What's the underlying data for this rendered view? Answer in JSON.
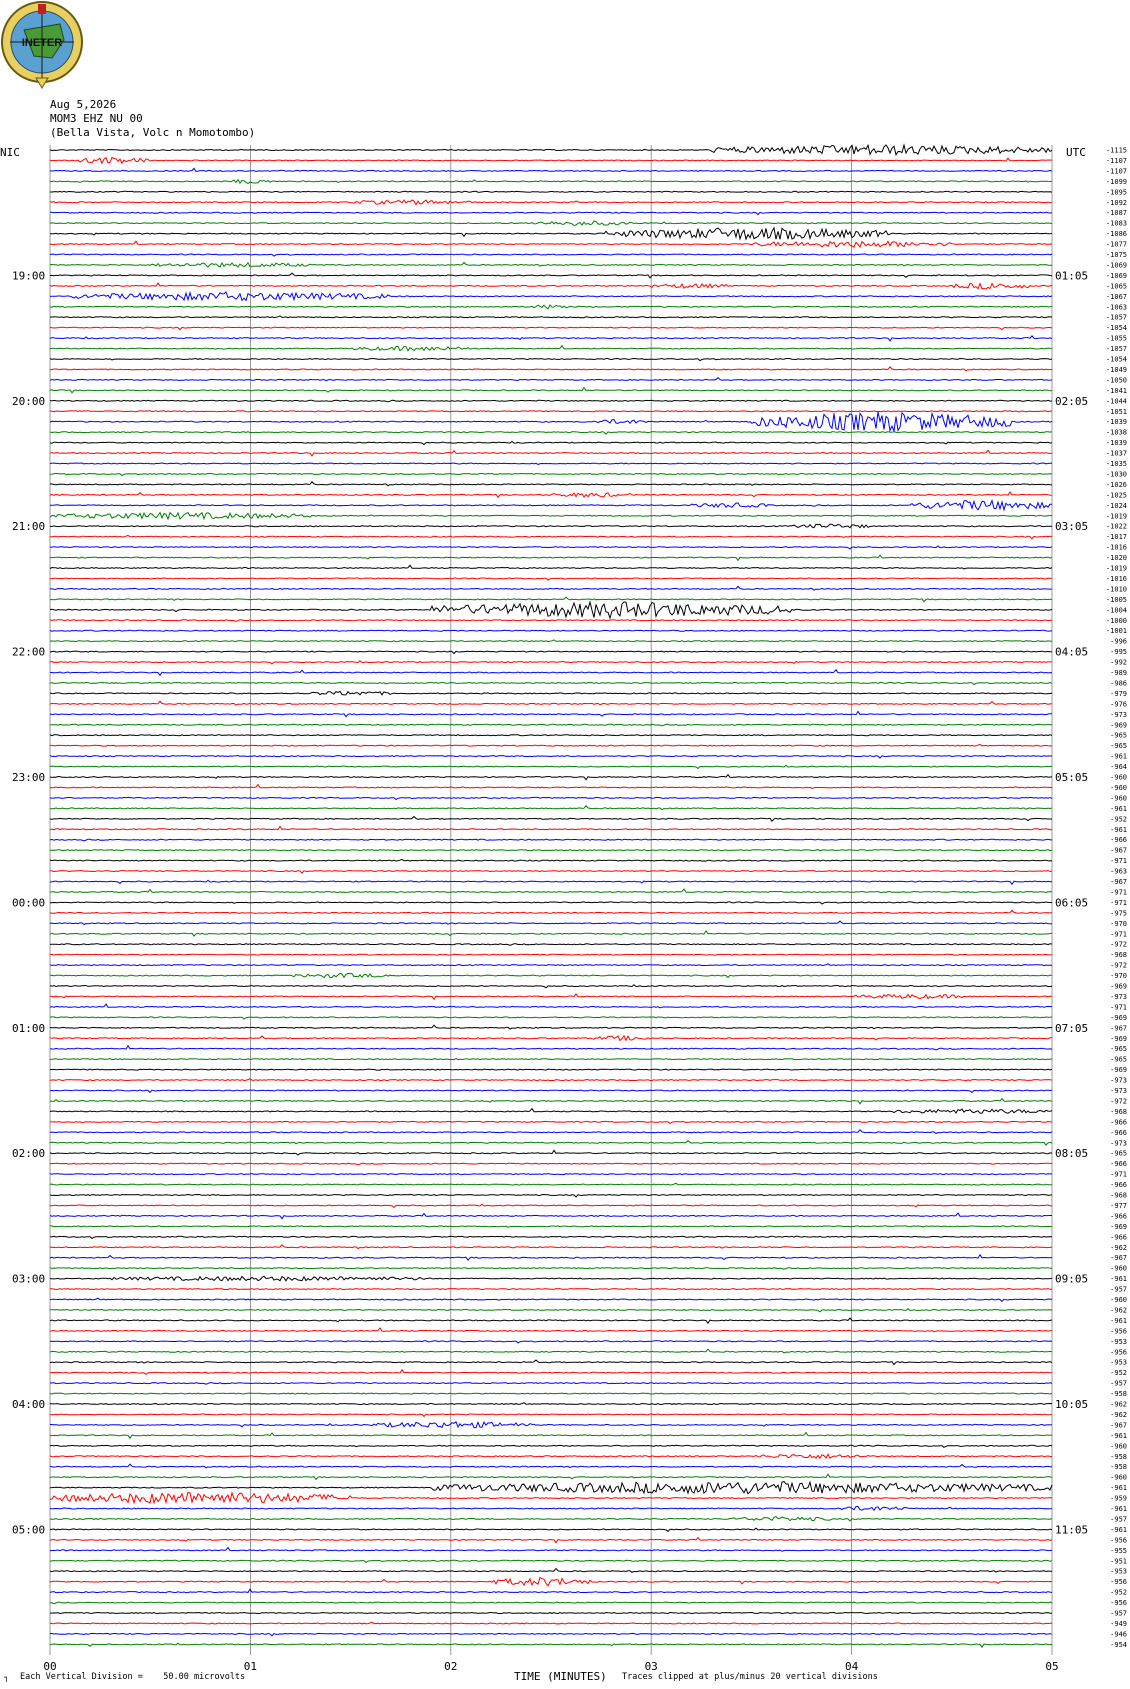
{
  "header": {
    "date": "Aug 5,2026",
    "station": "MOM3 EHZ NU 00",
    "location": "(Bella Vista, Volc n Momotombo)",
    "logo_text": "INETER"
  },
  "left_axis_title": "NIC",
  "right_axis_title": "UTC",
  "footer": {
    "scale_note": "Each Vertical Division =    50.00 microvolts",
    "scale_mark": "┐",
    "clip_note": "Traces clipped at plus/minus 20 vertical divisions"
  },
  "colors": {
    "trace_cycle": [
      "#000000",
      "#ff0000",
      "#0000ff",
      "#008000"
    ],
    "grid": "#808080"
  },
  "chart_data": {
    "type": "line",
    "xlabel": "TIME (MINUTES)",
    "x_ticks": [
      "00",
      "01",
      "02",
      "03",
      "04",
      "05"
    ],
    "xlim": [
      0,
      5
    ],
    "n_traces": 144,
    "left_hour_labels": [
      {
        "trace": 12,
        "label": "19:00"
      },
      {
        "trace": 24,
        "label": "20:00"
      },
      {
        "trace": 36,
        "label": "21:00"
      },
      {
        "trace": 48,
        "label": "22:00"
      },
      {
        "trace": 60,
        "label": "23:00"
      },
      {
        "trace": 72,
        "label": "00:00"
      },
      {
        "trace": 84,
        "label": "01:00"
      },
      {
        "trace": 96,
        "label": "02:00"
      },
      {
        "trace": 108,
        "label": "03:00"
      },
      {
        "trace": 120,
        "label": "04:00"
      },
      {
        "trace": 132,
        "label": "05:00"
      }
    ],
    "right_hour_labels": [
      {
        "trace": 12,
        "label": "01:05"
      },
      {
        "trace": 24,
        "label": "02:05"
      },
      {
        "trace": 36,
        "label": "03:05"
      },
      {
        "trace": 48,
        "label": "04:05"
      },
      {
        "trace": 60,
        "label": "05:05"
      },
      {
        "trace": 72,
        "label": "06:05"
      },
      {
        "trace": 84,
        "label": "07:05"
      },
      {
        "trace": 96,
        "label": "08:05"
      },
      {
        "trace": 108,
        "label": "09:05"
      },
      {
        "trace": 120,
        "label": "10:05"
      },
      {
        "trace": 132,
        "label": "11:05"
      }
    ],
    "trace_offsets": [
      "-1115",
      "-1107",
      "-1107",
      "-1099",
      "-1095",
      "-1092",
      "-1087",
      "-1083",
      "-1086",
      "-1077",
      "-1075",
      "-1069",
      "-1069",
      "-1065",
      "-1067",
      "-1063",
      "-1057",
      "-1054",
      "-1055",
      "-1057",
      "-1054",
      "-1049",
      "-1050",
      "-1041",
      "-1044",
      "-1051",
      "-1039",
      "-1038",
      "-1039",
      "-1037",
      "-1035",
      "-1030",
      "-1026",
      "-1025",
      "-1024",
      "-1019",
      "-1022",
      "-1017",
      "-1016",
      "-1020",
      "-1019",
      "-1016",
      "-1010",
      "-1005",
      "-1004",
      "-1000",
      "-1001",
      "-996",
      "-995",
      "-992",
      "-989",
      "-986",
      "-979",
      "-976",
      "-973",
      "-969",
      "-965",
      "-965",
      "-961",
      "-964",
      "-960",
      "-960",
      "-960",
      "-961",
      "-952",
      "-961",
      "-966",
      "-967",
      "-971",
      "-963",
      "-967",
      "-971",
      "-971",
      "-975",
      "-970",
      "-971",
      "-972",
      "-968",
      "-972",
      "-970",
      "-969",
      "-973",
      "-971",
      "-969",
      "-967",
      "-969",
      "-965",
      "-965",
      "-969",
      "-973",
      "-973",
      "-972",
      "-968",
      "-966",
      "-966",
      "-973",
      "-965",
      "-966",
      "-971",
      "-966",
      "-968",
      "-977",
      "-966",
      "-969",
      "-966",
      "-962",
      "-967",
      "-960",
      "-961",
      "-957",
      "-960",
      "-962",
      "-961",
      "-956",
      "-953",
      "-956",
      "-953",
      "-952",
      "-957",
      "-958",
      "-962",
      "-962",
      "-967",
      "-961",
      "-960",
      "-958",
      "-958",
      "-960",
      "-961",
      "-959",
      "-961",
      "-957",
      "-961",
      "-956",
      "-955",
      "-951",
      "-953",
      "-956",
      "-952",
      "-956",
      "-957",
      "-949",
      "-946",
      "-954"
    ]
  }
}
